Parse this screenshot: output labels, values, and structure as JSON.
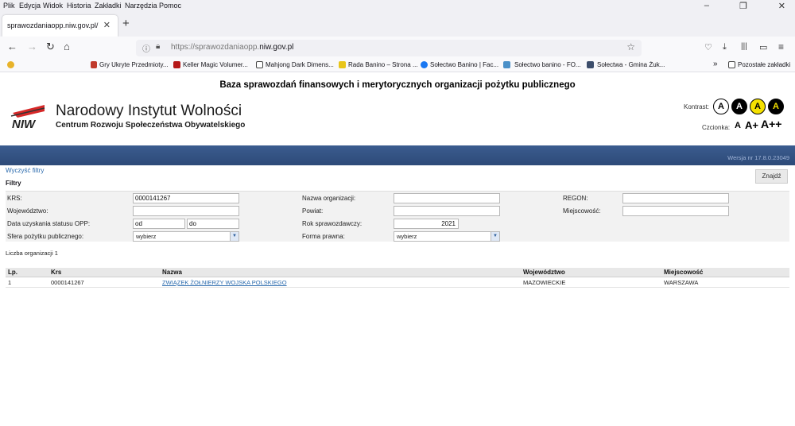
{
  "browser": {
    "menu": [
      "Plik",
      "Edycja",
      "Widok",
      "Historia",
      "Zakładki",
      "Narzędzia",
      "Pomoc"
    ],
    "tab_title": "sprawozdaniaopp.niw.gov.pl/",
    "url_prefix": "https://sprawozdaniaopp.",
    "url_domain": "niw.gov.pl",
    "bookmarks": [
      "Gry Ukryte Przedmioty...",
      "Keller Magic Volumer...",
      "Mahjong Dark Dimens...",
      "Rada Banino – Strona ...",
      "Sołectwo Banino | Fac...",
      "Sołectwo banino - FO...",
      "Sołectwa - Gmina Żuk..."
    ],
    "bookmarks_other": "Pozostałe zakładki"
  },
  "page": {
    "title": "Baza sprawozdań finansowych i merytorycznych organizacji pożytku publicznego",
    "logo_abbr": "NIW",
    "logo_main": "Narodowy Instytut Wolności",
    "logo_sub": "Centrum Rozwoju Społeczeństwa Obywatelskiego",
    "contrast_label": "Kontrast:",
    "contrast_letter": "A",
    "font_label": "Czcionka:",
    "font_sizes": [
      "A",
      "A+",
      "A++"
    ],
    "version": "Wersja nr 17.8.0.23049",
    "clear_filters": "Wyczyść filtry",
    "filters_title": "Filtry",
    "find_button": "Znajdź",
    "colors": {
      "header_bar": "#2d4a78",
      "link": "#2a6aad",
      "contrast_yellow": "#f5e100"
    }
  },
  "filters": {
    "krs_label": "KRS:",
    "krs_value": "0000141267",
    "org_name_label": "Nazwa organizacji:",
    "org_name_value": "",
    "regon_label": "REGON:",
    "regon_value": "",
    "voivodeship_label": "Województwo:",
    "voivodeship_value": "",
    "county_label": "Powiat:",
    "county_value": "",
    "city_label": "Miejscowość:",
    "city_value": "",
    "opp_date_label": "Data uzyskania statusu OPP:",
    "opp_date_from": "od",
    "opp_date_to": "do",
    "report_year_label": "Rok sprawozdawczy:",
    "report_year_value": "2021",
    "public_benefit_label": "Sfera pożytku publicznego:",
    "public_benefit_value": "wybierz",
    "legal_form_label": "Forma prawna:",
    "legal_form_value": "wybierz"
  },
  "results": {
    "count_text": "Liczba organizacji 1",
    "headers": [
      "Lp.",
      "Krs",
      "Nazwa",
      "Województwo",
      "Miejscowość"
    ],
    "rows": [
      {
        "lp": "1",
        "krs": "0000141267",
        "name": "ZWIĄZEK ŻOŁNIERZY WOJSKA POLSKIEGO",
        "voivodeship": "MAZOWIECKIE",
        "city": "WARSZAWA"
      }
    ]
  }
}
